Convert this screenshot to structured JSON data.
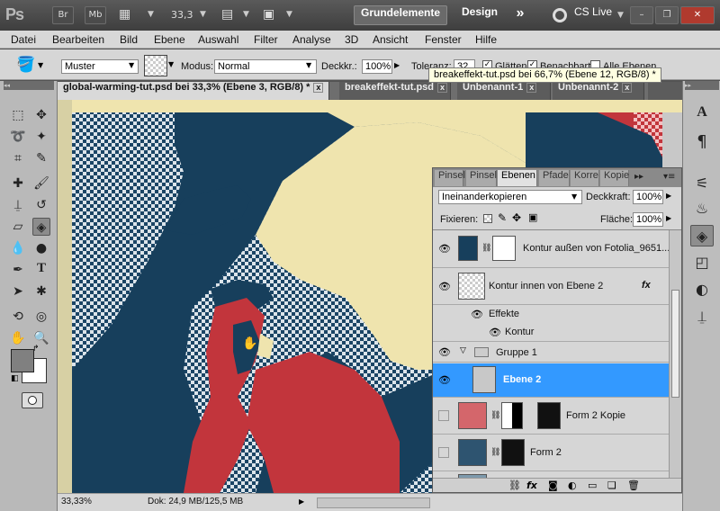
{
  "app": {
    "logo": "Ps",
    "bridge_btn": "Br",
    "minibridge_btn": "Mb",
    "zoom_value": "33,3",
    "workspaces": [
      "Grundelemente",
      "Design"
    ],
    "more_workspaces": "»",
    "cs_live": "CS Live",
    "window_controls": [
      "–",
      "❐",
      "✕"
    ]
  },
  "menu": [
    "Datei",
    "Bearbeiten",
    "Bild",
    "Ebene",
    "Auswahl",
    "Filter",
    "Analyse",
    "3D",
    "Ansicht",
    "Fenster",
    "Hilfe"
  ],
  "options": {
    "fill_source": "Muster",
    "mode_label": "Modus:",
    "mode_value": "Normal",
    "opacity_label": "Deckkr.:",
    "opacity_value": "100%",
    "tolerance_label": "Toleranz:",
    "tolerance_value": "32",
    "antialias_label": "Glätten",
    "contiguous_label": "Benachbart",
    "all_layers_label": "Alle Ebenen"
  },
  "tooltip": "breakeffekt-tut.psd bei 66,7% (Ebene 12, RGB/8) *",
  "tabs": [
    {
      "label": "global-warming-tut.psd bei 33,3% (Ebene 3, RGB/8) *",
      "active": true
    },
    {
      "label": "breakeffekt-tut.psd",
      "active": false
    },
    {
      "label": "Unbenannt-1",
      "active": false
    },
    {
      "label": "Unbenannt-2",
      "active": false
    }
  ],
  "status": {
    "zoom": "33,33%",
    "doc_info": "Dok: 24,9 MB/125,5 MB"
  },
  "layers_panel": {
    "tabs": [
      "Pinsel",
      "Pinsel",
      "Ebenen",
      "Pfade",
      "Korre",
      "Kopie"
    ],
    "blend_mode": "Ineinanderkopieren",
    "opacity_label": "Deckkraft:",
    "opacity_value": "100%",
    "lock_label": "Fixieren:",
    "fill_label": "Fläche:",
    "fill_value": "100%",
    "layers": [
      {
        "name": "Kontur außen von Fotolia_9651..."
      },
      {
        "name": "Kontur innen von Ebene 2",
        "fx": "fx"
      },
      {
        "name": "Effekte"
      },
      {
        "name": "Kontur"
      },
      {
        "name": "Gruppe 1"
      },
      {
        "name": "Ebene 2"
      },
      {
        "name": "Form 2 Kopie"
      },
      {
        "name": "Form 2"
      }
    ]
  },
  "colors": {
    "poster_blue": "#173f5c",
    "poster_red": "#c2353c",
    "poster_cream": "#efe4ae",
    "selection_blue": "#3399ff",
    "foreground": "#808080",
    "background": "#ffffff"
  }
}
